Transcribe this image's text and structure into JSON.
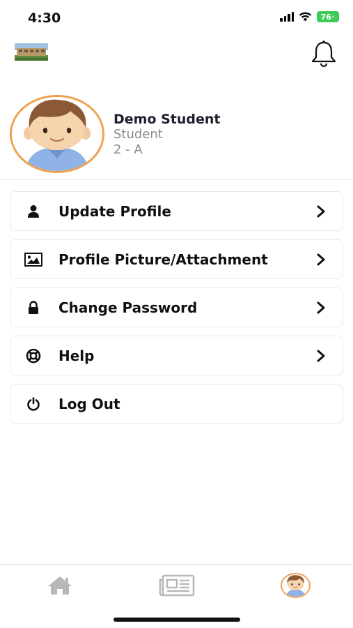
{
  "status_bar": {
    "time": "4:30",
    "battery": "76",
    "icons": [
      "signal-icon",
      "wifi-icon",
      "battery-icon"
    ]
  },
  "header": {
    "logo": "school-logo",
    "notification_icon": "bell-icon"
  },
  "profile": {
    "name": "Demo Student",
    "role": "Student",
    "class": "2 - A",
    "avatar": "student-avatar"
  },
  "menu": {
    "items": [
      {
        "label": "Update Profile",
        "icon": "user-icon",
        "has_chevron": true
      },
      {
        "label": "Profile Picture/Attachment",
        "icon": "image-icon",
        "has_chevron": true
      },
      {
        "label": "Change Password",
        "icon": "lock-icon",
        "has_chevron": true
      },
      {
        "label": "Help",
        "icon": "lifebuoy-icon",
        "has_chevron": true
      },
      {
        "label": "Log Out",
        "icon": "power-icon",
        "has_chevron": false
      }
    ]
  },
  "tabbar": {
    "tabs": [
      {
        "name": "home",
        "icon": "home-icon",
        "active": false
      },
      {
        "name": "news",
        "icon": "newspaper-icon",
        "active": false
      },
      {
        "name": "profile",
        "icon": "avatar-icon",
        "active": true
      }
    ]
  },
  "colors": {
    "avatar_ring": "#f0a04a",
    "battery": "#3ecb5a",
    "inactive_tab": "#b8b8b8",
    "secondary_text": "#8a8a8a"
  }
}
